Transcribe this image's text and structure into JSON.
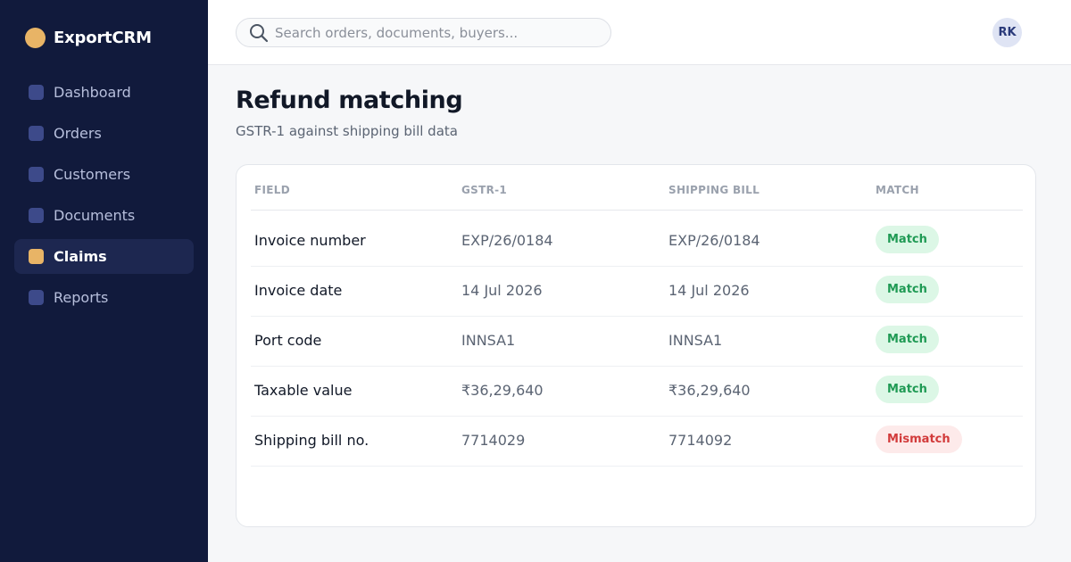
{
  "app": {
    "name": "ExportCRM",
    "brand_color": "#e8b466",
    "sidebar_color": "#111a3c"
  },
  "sidebar": {
    "items": [
      {
        "label": "Dashboard",
        "active": false
      },
      {
        "label": "Orders",
        "active": false
      },
      {
        "label": "Customers",
        "active": false
      },
      {
        "label": "Documents",
        "active": false
      },
      {
        "label": "Claims",
        "active": true
      },
      {
        "label": "Reports",
        "active": false
      }
    ]
  },
  "topbar": {
    "search_placeholder": "Search orders, documents, buyers...",
    "search_icon": "search-icon",
    "avatar_initials": "RK"
  },
  "page": {
    "title": "Refund matching",
    "subtitle": "GSTR-1 against shipping bill data"
  },
  "table": {
    "columns": [
      "FIELD",
      "GSTR-1",
      "SHIPPING BILL",
      "MATCH"
    ],
    "rows": [
      {
        "field": "Invoice number",
        "gstr": "EXP/26/0184",
        "shipping_bill": "EXP/26/0184",
        "match": "Match",
        "status": "ok"
      },
      {
        "field": "Invoice date",
        "gstr": "14 Jul 2026",
        "shipping_bill": "14 Jul 2026",
        "match": "Match",
        "status": "ok"
      },
      {
        "field": "Port code",
        "gstr": "INNSA1",
        "shipping_bill": "INNSA1",
        "match": "Match",
        "status": "ok"
      },
      {
        "field": "Taxable value",
        "gstr": "₹36,29,640",
        "shipping_bill": "₹36,29,640",
        "match": "Match",
        "status": "ok"
      },
      {
        "field": "Shipping bill no.",
        "gstr": "7714029",
        "shipping_bill": "7714092",
        "match": "Mismatch",
        "status": "bad"
      }
    ],
    "match_color": "#1f9a54",
    "mismatch_color": "#d23b3b"
  }
}
